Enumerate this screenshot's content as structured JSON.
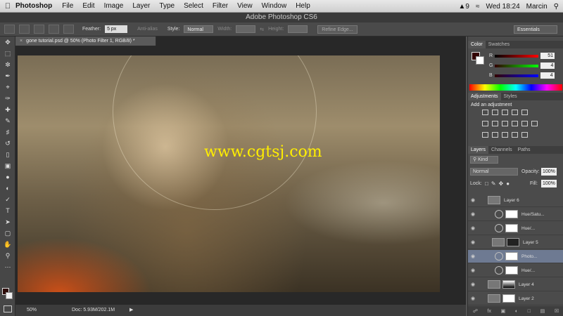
{
  "menubar": {
    "apple": "",
    "app": "Photoshop",
    "items": [
      "File",
      "Edit",
      "Image",
      "Layer",
      "Type",
      "Select",
      "Filter",
      "View",
      "Window",
      "Help"
    ],
    "status": {
      "notif": "9",
      "time": "Wed 18:24",
      "user": "Marcin"
    }
  },
  "window": {
    "title": "Adobe Photoshop CS6"
  },
  "options": {
    "feather_label": "Feather:",
    "feather_value": "5 px",
    "antialias": "Anti-alias",
    "style_label": "Style:",
    "style_value": "Normal",
    "width_label": "Width:",
    "height_label": "Height:",
    "refine": "Refine Edge...",
    "workspace": "Essentials"
  },
  "document": {
    "tab": "gone tutorial.psd @ 50% (Photo Filter 1, RGB/8) *",
    "zoom": "50%",
    "doc_size": "Doc: 5.93M/202.1M",
    "watermark": "www.cgtsj.com"
  },
  "color": {
    "tabs": [
      "Color",
      "Swatches"
    ],
    "r_label": "R",
    "r": "51",
    "g_label": "G",
    "g": "4",
    "b_label": "B",
    "b": "4",
    "fg": "#330404"
  },
  "adjustments": {
    "tabs": [
      "Adjustments",
      "Styles"
    ],
    "heading": "Add an adjustment"
  },
  "layers": {
    "tabs": [
      "Layers",
      "Channels",
      "Paths"
    ],
    "kind": "Kind",
    "blend": "Normal",
    "opacity_label": "Opacity:",
    "opacity": "100%",
    "lock_label": "Lock:",
    "fill_label": "Fill:",
    "fill": "100%",
    "rows": [
      {
        "name": "Layer 6"
      },
      {
        "name": "Hue/Satu..."
      },
      {
        "name": "Hue/..."
      },
      {
        "name": "Layer 5"
      },
      {
        "name": "Photo..."
      },
      {
        "name": "Hue/..."
      },
      {
        "name": "Layer 4"
      },
      {
        "name": "Layer 2"
      }
    ],
    "footer": "fx"
  }
}
